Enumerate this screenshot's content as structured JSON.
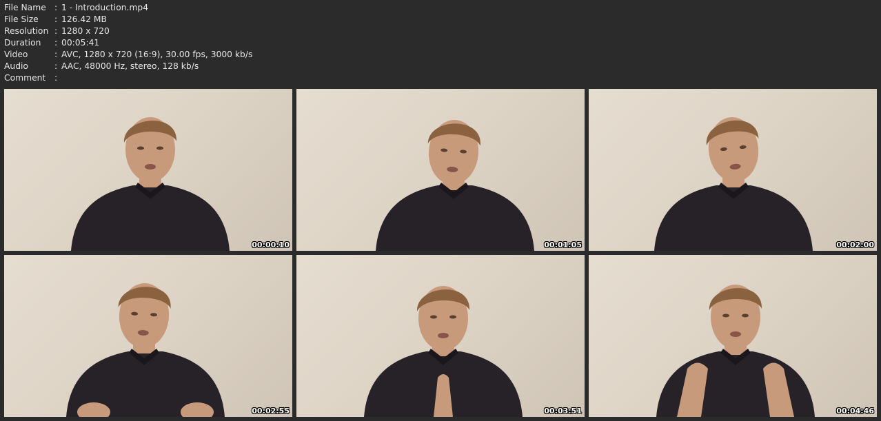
{
  "file_info": [
    {
      "label": "File Name",
      "sep": ":",
      "value": "1 - Introduction.mp4"
    },
    {
      "label": "File Size",
      "sep": ":",
      "value": "126.42 MB"
    },
    {
      "label": "Resolution",
      "sep": ":",
      "value": "1280 x 720"
    },
    {
      "label": "Duration",
      "sep": ":",
      "value": "00:05:41"
    },
    {
      "label": "Video",
      "sep": ":",
      "value": "AVC, 1280 x 720 (16:9), 30.00 fps, 3000 kb/s"
    },
    {
      "label": "Audio",
      "sep": ":",
      "value": "AAC, 48000 Hz, stereo, 128 kb/s"
    },
    {
      "label": "Comment",
      "sep": ":",
      "value": ""
    }
  ],
  "thumbnails": [
    {
      "timestamp": "00:00:10",
      "pose": "speaking"
    },
    {
      "timestamp": "00:01:05",
      "pose": "neutral"
    },
    {
      "timestamp": "00:02:00",
      "pose": "head-tilt"
    },
    {
      "timestamp": "00:02:55",
      "pose": "hands-low"
    },
    {
      "timestamp": "00:03:51",
      "pose": "hands-together"
    },
    {
      "timestamp": "00:04:46",
      "pose": "hands-raised"
    }
  ],
  "colors": {
    "background": "#2b2b2b",
    "text": "#e6e6e6",
    "wall": "#e1d8cb",
    "shirt": "#262228",
    "skin": "#c89a7c",
    "hair": "#8a6240"
  }
}
